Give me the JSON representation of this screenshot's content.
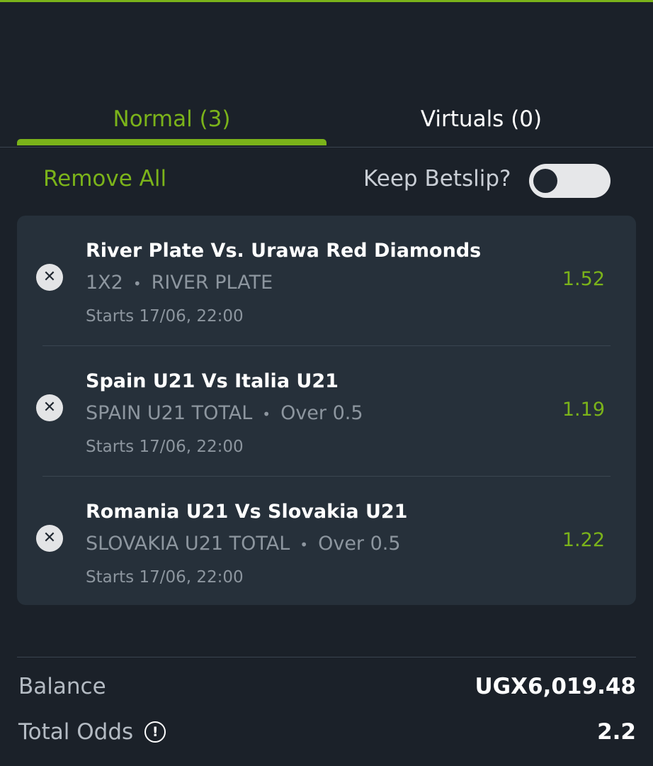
{
  "tabs": {
    "normal_label": "Normal (3)",
    "virtuals_label": "Virtuals (0)"
  },
  "toolbar": {
    "remove_all_label": "Remove All",
    "keep_betslip_label": "Keep Betslip?",
    "keep_betslip_on": false
  },
  "bets": [
    {
      "match": "River Plate Vs. Urawa Red Diamonds",
      "market": "1X2",
      "selection": "RIVER PLATE",
      "starts": "Starts 17/06, 22:00",
      "odds": "1.52"
    },
    {
      "match": "Spain U21 Vs Italia U21",
      "market": "SPAIN U21 TOTAL",
      "selection": "Over 0.5",
      "starts": "Starts 17/06, 22:00",
      "odds": "1.19"
    },
    {
      "match": "Romania U21 Vs Slovakia U21",
      "market": "SLOVAKIA U21 TOTAL",
      "selection": "Over 0.5",
      "starts": "Starts 17/06, 22:00",
      "odds": "1.22"
    }
  ],
  "summary": {
    "balance_label": "Balance",
    "balance_value": "UGX6,019.48",
    "total_odds_label": "Total Odds",
    "total_odds_value": "2.2",
    "info_icon_glyph": "!"
  },
  "icons": {
    "remove_bet": "close-icon",
    "total_odds_info": "info-icon"
  },
  "colors": {
    "accent": "#7bb31a",
    "background": "#1b2129",
    "card": "#26303a"
  }
}
